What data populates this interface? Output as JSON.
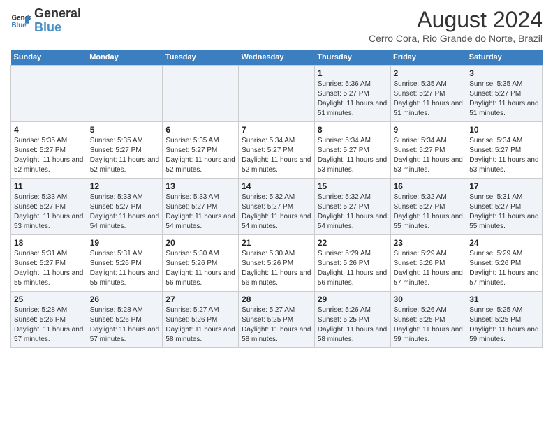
{
  "logo": {
    "line1": "General",
    "line2": "Blue"
  },
  "title": "August 2024",
  "subtitle": "Cerro Cora, Rio Grande do Norte, Brazil",
  "days_of_week": [
    "Sunday",
    "Monday",
    "Tuesday",
    "Wednesday",
    "Thursday",
    "Friday",
    "Saturday"
  ],
  "weeks": [
    [
      {
        "day": "",
        "info": ""
      },
      {
        "day": "",
        "info": ""
      },
      {
        "day": "",
        "info": ""
      },
      {
        "day": "",
        "info": ""
      },
      {
        "day": "1",
        "info": "Sunrise: 5:36 AM\nSunset: 5:27 PM\nDaylight: 11 hours and 51 minutes."
      },
      {
        "day": "2",
        "info": "Sunrise: 5:35 AM\nSunset: 5:27 PM\nDaylight: 11 hours and 51 minutes."
      },
      {
        "day": "3",
        "info": "Sunrise: 5:35 AM\nSunset: 5:27 PM\nDaylight: 11 hours and 51 minutes."
      }
    ],
    [
      {
        "day": "4",
        "info": "Sunrise: 5:35 AM\nSunset: 5:27 PM\nDaylight: 11 hours and 52 minutes."
      },
      {
        "day": "5",
        "info": "Sunrise: 5:35 AM\nSunset: 5:27 PM\nDaylight: 11 hours and 52 minutes."
      },
      {
        "day": "6",
        "info": "Sunrise: 5:35 AM\nSunset: 5:27 PM\nDaylight: 11 hours and 52 minutes."
      },
      {
        "day": "7",
        "info": "Sunrise: 5:34 AM\nSunset: 5:27 PM\nDaylight: 11 hours and 52 minutes."
      },
      {
        "day": "8",
        "info": "Sunrise: 5:34 AM\nSunset: 5:27 PM\nDaylight: 11 hours and 53 minutes."
      },
      {
        "day": "9",
        "info": "Sunrise: 5:34 AM\nSunset: 5:27 PM\nDaylight: 11 hours and 53 minutes."
      },
      {
        "day": "10",
        "info": "Sunrise: 5:34 AM\nSunset: 5:27 PM\nDaylight: 11 hours and 53 minutes."
      }
    ],
    [
      {
        "day": "11",
        "info": "Sunrise: 5:33 AM\nSunset: 5:27 PM\nDaylight: 11 hours and 53 minutes."
      },
      {
        "day": "12",
        "info": "Sunrise: 5:33 AM\nSunset: 5:27 PM\nDaylight: 11 hours and 54 minutes."
      },
      {
        "day": "13",
        "info": "Sunrise: 5:33 AM\nSunset: 5:27 PM\nDaylight: 11 hours and 54 minutes."
      },
      {
        "day": "14",
        "info": "Sunrise: 5:32 AM\nSunset: 5:27 PM\nDaylight: 11 hours and 54 minutes."
      },
      {
        "day": "15",
        "info": "Sunrise: 5:32 AM\nSunset: 5:27 PM\nDaylight: 11 hours and 54 minutes."
      },
      {
        "day": "16",
        "info": "Sunrise: 5:32 AM\nSunset: 5:27 PM\nDaylight: 11 hours and 55 minutes."
      },
      {
        "day": "17",
        "info": "Sunrise: 5:31 AM\nSunset: 5:27 PM\nDaylight: 11 hours and 55 minutes."
      }
    ],
    [
      {
        "day": "18",
        "info": "Sunrise: 5:31 AM\nSunset: 5:27 PM\nDaylight: 11 hours and 55 minutes."
      },
      {
        "day": "19",
        "info": "Sunrise: 5:31 AM\nSunset: 5:26 PM\nDaylight: 11 hours and 55 minutes."
      },
      {
        "day": "20",
        "info": "Sunrise: 5:30 AM\nSunset: 5:26 PM\nDaylight: 11 hours and 56 minutes."
      },
      {
        "day": "21",
        "info": "Sunrise: 5:30 AM\nSunset: 5:26 PM\nDaylight: 11 hours and 56 minutes."
      },
      {
        "day": "22",
        "info": "Sunrise: 5:29 AM\nSunset: 5:26 PM\nDaylight: 11 hours and 56 minutes."
      },
      {
        "day": "23",
        "info": "Sunrise: 5:29 AM\nSunset: 5:26 PM\nDaylight: 11 hours and 57 minutes."
      },
      {
        "day": "24",
        "info": "Sunrise: 5:29 AM\nSunset: 5:26 PM\nDaylight: 11 hours and 57 minutes."
      }
    ],
    [
      {
        "day": "25",
        "info": "Sunrise: 5:28 AM\nSunset: 5:26 PM\nDaylight: 11 hours and 57 minutes."
      },
      {
        "day": "26",
        "info": "Sunrise: 5:28 AM\nSunset: 5:26 PM\nDaylight: 11 hours and 57 minutes."
      },
      {
        "day": "27",
        "info": "Sunrise: 5:27 AM\nSunset: 5:26 PM\nDaylight: 11 hours and 58 minutes."
      },
      {
        "day": "28",
        "info": "Sunrise: 5:27 AM\nSunset: 5:25 PM\nDaylight: 11 hours and 58 minutes."
      },
      {
        "day": "29",
        "info": "Sunrise: 5:26 AM\nSunset: 5:25 PM\nDaylight: 11 hours and 58 minutes."
      },
      {
        "day": "30",
        "info": "Sunrise: 5:26 AM\nSunset: 5:25 PM\nDaylight: 11 hours and 59 minutes."
      },
      {
        "day": "31",
        "info": "Sunrise: 5:25 AM\nSunset: 5:25 PM\nDaylight: 11 hours and 59 minutes."
      }
    ]
  ]
}
